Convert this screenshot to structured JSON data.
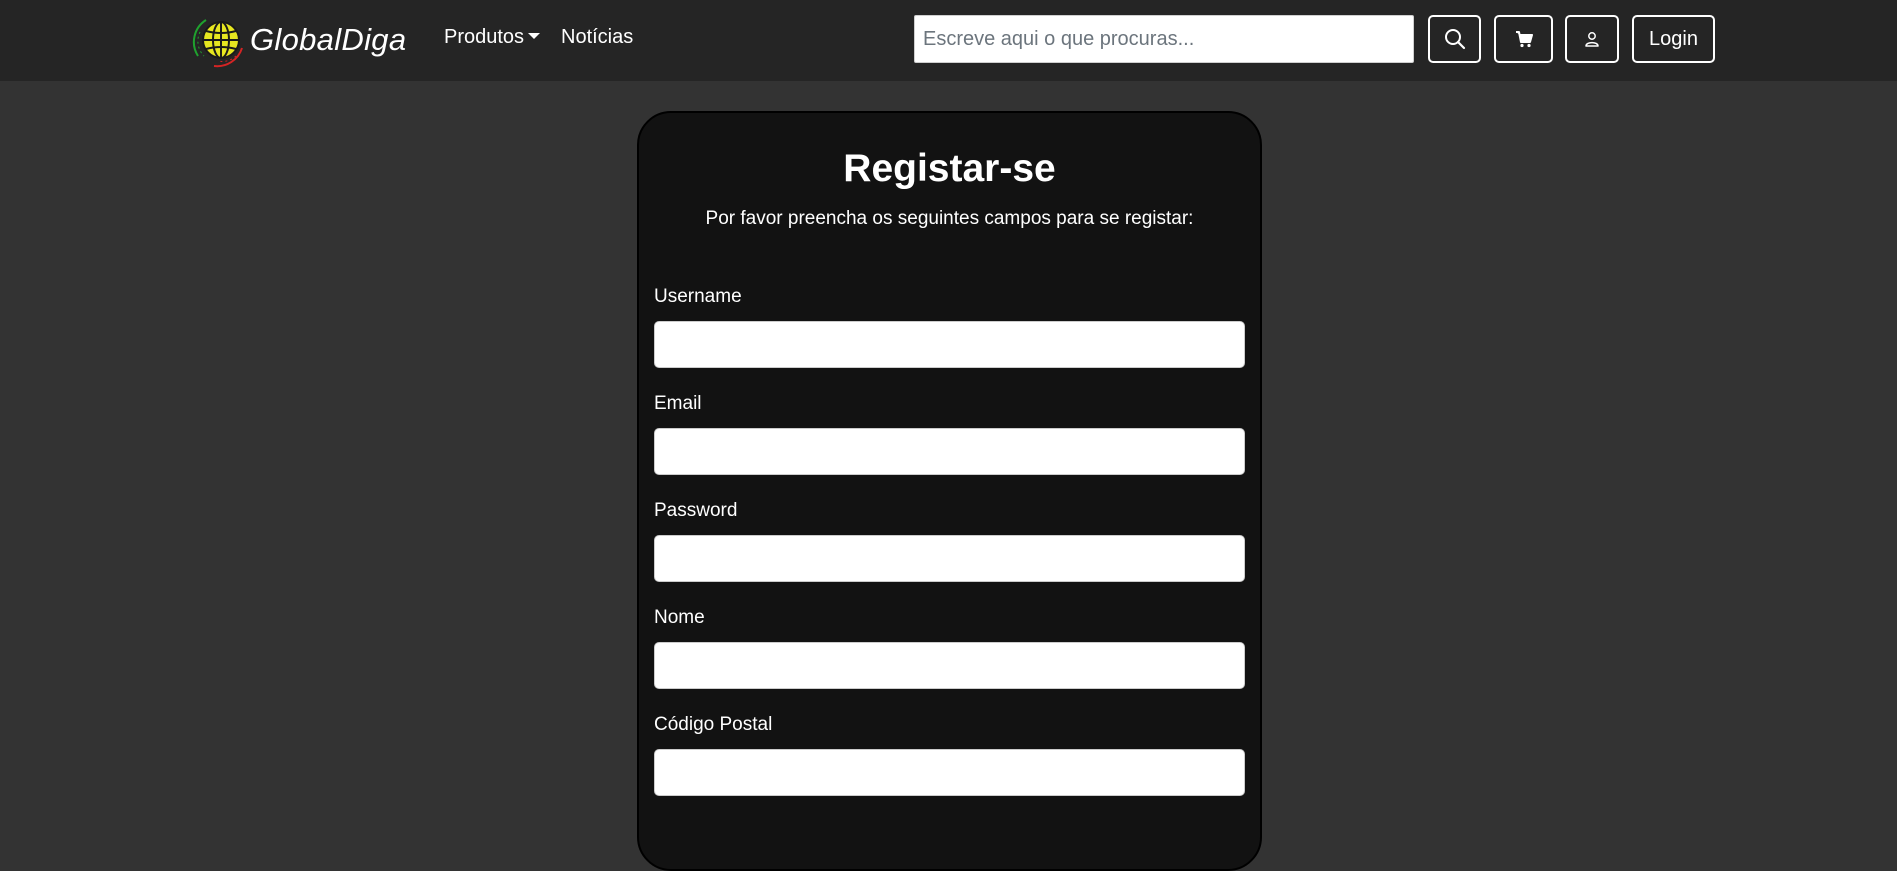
{
  "navbar": {
    "brand_name": "GlobalDiga",
    "links": [
      {
        "label": "Produtos",
        "has_dropdown": true
      },
      {
        "label": "Notícias"
      }
    ],
    "search": {
      "placeholder": "Escreve aqui o que procuras...",
      "value": ""
    },
    "buttons": {
      "search_icon": "search-icon",
      "cart_icon": "cart-icon",
      "user_icon": "user-icon",
      "login_label": "Login"
    },
    "colors": {
      "background": "#252525",
      "logo_globe": "#e6e620",
      "logo_arc_green": "#1fa32e",
      "logo_arc_red": "#d42424"
    }
  },
  "form": {
    "title": "Registar-se",
    "subtitle": "Por favor preencha os seguintes campos para se registar:",
    "fields": [
      {
        "label": "Username",
        "value": ""
      },
      {
        "label": "Email",
        "value": ""
      },
      {
        "label": "Password",
        "value": ""
      },
      {
        "label": "Nome",
        "value": ""
      },
      {
        "label": "Código Postal",
        "value": ""
      }
    ]
  },
  "colors": {
    "page_background": "#333333",
    "card_background": "#121212",
    "input_background": "#ffffff",
    "text": "#ffffff"
  }
}
